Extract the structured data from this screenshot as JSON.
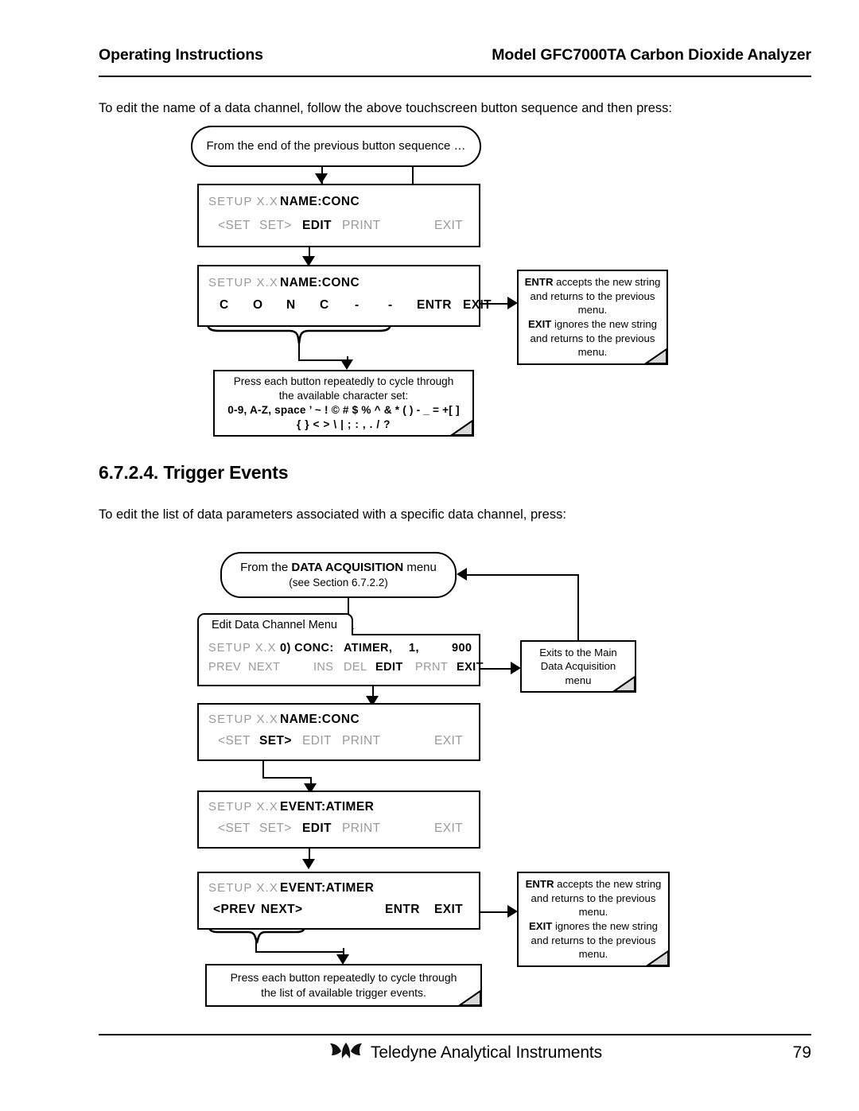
{
  "header": {
    "left": "Operating Instructions",
    "right": "Model GFC7000TA Carbon Dioxide Analyzer"
  },
  "intro_paragraph_1": "To edit the name of a data channel, follow the above touchscreen button sequence and then press:",
  "section": {
    "heading": "6.7.2.4. Trigger Events",
    "intro_paragraph": "To edit the list of data parameters associated with a specific data channel, press:"
  },
  "flow_name_edit": {
    "start_capsule": "From the end of the previous button sequence …",
    "display_1": {
      "setup": "SETUP X.X",
      "title": "NAME:CONC",
      "buttons": [
        {
          "label": "<SET",
          "state": "dim"
        },
        {
          "label": "SET>",
          "state": "dim"
        },
        {
          "label": "EDIT",
          "state": "on"
        },
        {
          "label": "PRINT",
          "state": "dim"
        },
        {
          "label": "EXIT",
          "state": "dim"
        }
      ]
    },
    "display_2": {
      "setup": "SETUP X.X",
      "title": "NAME:CONC",
      "characters": [
        "C",
        "O",
        "N",
        "C",
        "-",
        "-"
      ],
      "buttons": [
        {
          "label": "ENTR",
          "state": "on"
        },
        {
          "label": "EXIT",
          "state": "on"
        }
      ]
    },
    "entr_exit_note": {
      "line_1_bold": "ENTR",
      "line_1_rest": " accepts the new string",
      "line_2": "and returns to the previous",
      "line_3": "menu.",
      "line_4_bold": "EXIT",
      "line_4_rest": " ignores the new string",
      "line_5": "and returns to the previous",
      "line_6": "menu."
    },
    "charset_note": {
      "line_1": "Press each button repeatedly to cycle through",
      "line_2": "the available character set:",
      "line_3": "0-9, A-Z, space ’ ~ ! © # $ % ^ & * ( ) - _ = +[ ]",
      "line_4": "{ } < > \\ | ; : , . / ?"
    }
  },
  "flow_trigger_events": {
    "start_capsule_prefix": "From the ",
    "start_capsule_bold": "DATA ACQUISITION",
    "start_capsule_suffix": " menu",
    "start_capsule_sub": "(see Section 6.7.2.2)",
    "tab_label": "Edit Data Channel Menu",
    "display_1": {
      "setup": "SETUP X.X",
      "title_fields": [
        "0) CONC:",
        "ATIMER,",
        "1,",
        "900"
      ],
      "buttons": [
        {
          "label": "PREV",
          "state": "dim"
        },
        {
          "label": "NEXT",
          "state": "dim"
        },
        {
          "label": "INS",
          "state": "dim"
        },
        {
          "label": "DEL",
          "state": "dim"
        },
        {
          "label": "EDIT",
          "state": "on"
        },
        {
          "label": "PRNT",
          "state": "dim"
        },
        {
          "label": "EXIT",
          "state": "on"
        }
      ]
    },
    "exit_note": {
      "line_1": "Exits to the Main",
      "line_2": "Data Acquisition",
      "line_3": "menu"
    },
    "display_2": {
      "setup": "SETUP X.X",
      "title": "NAME:CONC",
      "buttons": [
        {
          "label": "<SET",
          "state": "dim"
        },
        {
          "label": "SET>",
          "state": "on"
        },
        {
          "label": "EDIT",
          "state": "dim"
        },
        {
          "label": "PRINT",
          "state": "dim"
        },
        {
          "label": "EXIT",
          "state": "dim"
        }
      ]
    },
    "display_3": {
      "setup": "SETUP X.X",
      "title": "EVENT:ATIMER",
      "buttons": [
        {
          "label": "<SET",
          "state": "dim"
        },
        {
          "label": "SET>",
          "state": "dim"
        },
        {
          "label": "EDIT",
          "state": "on"
        },
        {
          "label": "PRINT",
          "state": "dim"
        },
        {
          "label": "EXIT",
          "state": "dim"
        }
      ]
    },
    "display_4": {
      "setup": "SETUP X.X",
      "title": "EVENT:ATIMER",
      "nav_buttons": [
        "<PREV",
        "NEXT>"
      ],
      "buttons": [
        {
          "label": "ENTR",
          "state": "on"
        },
        {
          "label": "EXIT",
          "state": "on"
        }
      ]
    },
    "entr_exit_note": {
      "line_1_bold": "ENTR",
      "line_1_rest": " accepts the new string",
      "line_2": "and returns to the previous",
      "line_3": "menu.",
      "line_4_bold": "EXIT",
      "line_4_rest": " ignores the new string",
      "line_5": "and returns to the previous",
      "line_6": "menu."
    },
    "cycle_note": {
      "line_1": "Press each button repeatedly to cycle through",
      "line_2": "the list of available trigger events."
    }
  },
  "footer": {
    "company": "Teledyne Analytical Instruments",
    "page_number": "79",
    "logo": "teledyne-wings-logo"
  }
}
